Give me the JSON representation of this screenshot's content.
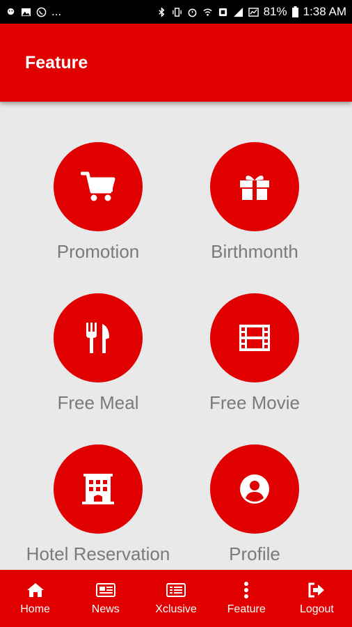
{
  "status_bar": {
    "left_icons": [
      "chat-head-icon",
      "image-icon",
      "whatsapp-icon",
      "more-dots"
    ],
    "more": "...",
    "right_icons": [
      "bluetooth-icon",
      "vibrate-icon",
      "alarm-icon",
      "wifi-icon",
      "nfc-icon",
      "signal-icon",
      "battery-icon"
    ],
    "battery": "81%",
    "time": "1:38 AM"
  },
  "app_bar": {
    "title": "Feature",
    "color": "#e00000"
  },
  "features": [
    {
      "label": "Promotion",
      "icon": "cart-icon"
    },
    {
      "label": "Birthmonth",
      "icon": "gift-icon"
    },
    {
      "label": "Free Meal",
      "icon": "cutlery-icon"
    },
    {
      "label": "Free Movie",
      "icon": "film-icon"
    },
    {
      "label": "Hotel Reservation",
      "icon": "hotel-icon"
    },
    {
      "label": "Profile",
      "icon": "user-circle-icon"
    }
  ],
  "bottom_nav": [
    {
      "label": "Home",
      "icon": "home-icon"
    },
    {
      "label": "News",
      "icon": "newspaper-icon"
    },
    {
      "label": "Xclusive",
      "icon": "list-icon"
    },
    {
      "label": "Feature",
      "icon": "vertical-dots-icon"
    },
    {
      "label": "Logout",
      "icon": "logout-icon"
    }
  ],
  "colors": {
    "accent": "#e00000",
    "label_gray": "#7a7a7a",
    "background": "#e9e9e9"
  }
}
